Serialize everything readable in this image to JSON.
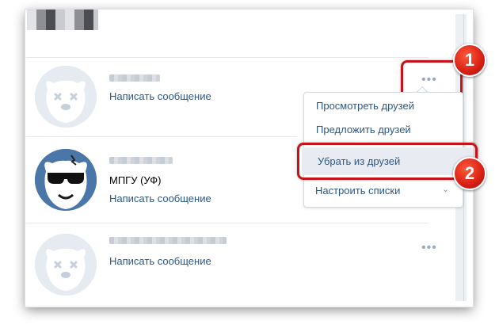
{
  "friends": [
    {
      "action_label": "Написать сообщение"
    },
    {
      "subtitle": "МПГУ (УФ)",
      "action_label": "Написать сообщение"
    },
    {
      "action_label": "Написать сообщение"
    }
  ],
  "menu": {
    "items": [
      {
        "label": "Просмотреть друзей"
      },
      {
        "label": "Предложить друзей"
      },
      {
        "label": "Убрать из друзей"
      },
      {
        "label": "Настроить списки"
      }
    ]
  },
  "icons": {
    "more": "•••",
    "chevron": "⌄"
  },
  "badges": [
    "1",
    "2"
  ],
  "colors": {
    "link": "#2a5885",
    "highlight": "#c9111a",
    "badge": "#d71f14"
  }
}
